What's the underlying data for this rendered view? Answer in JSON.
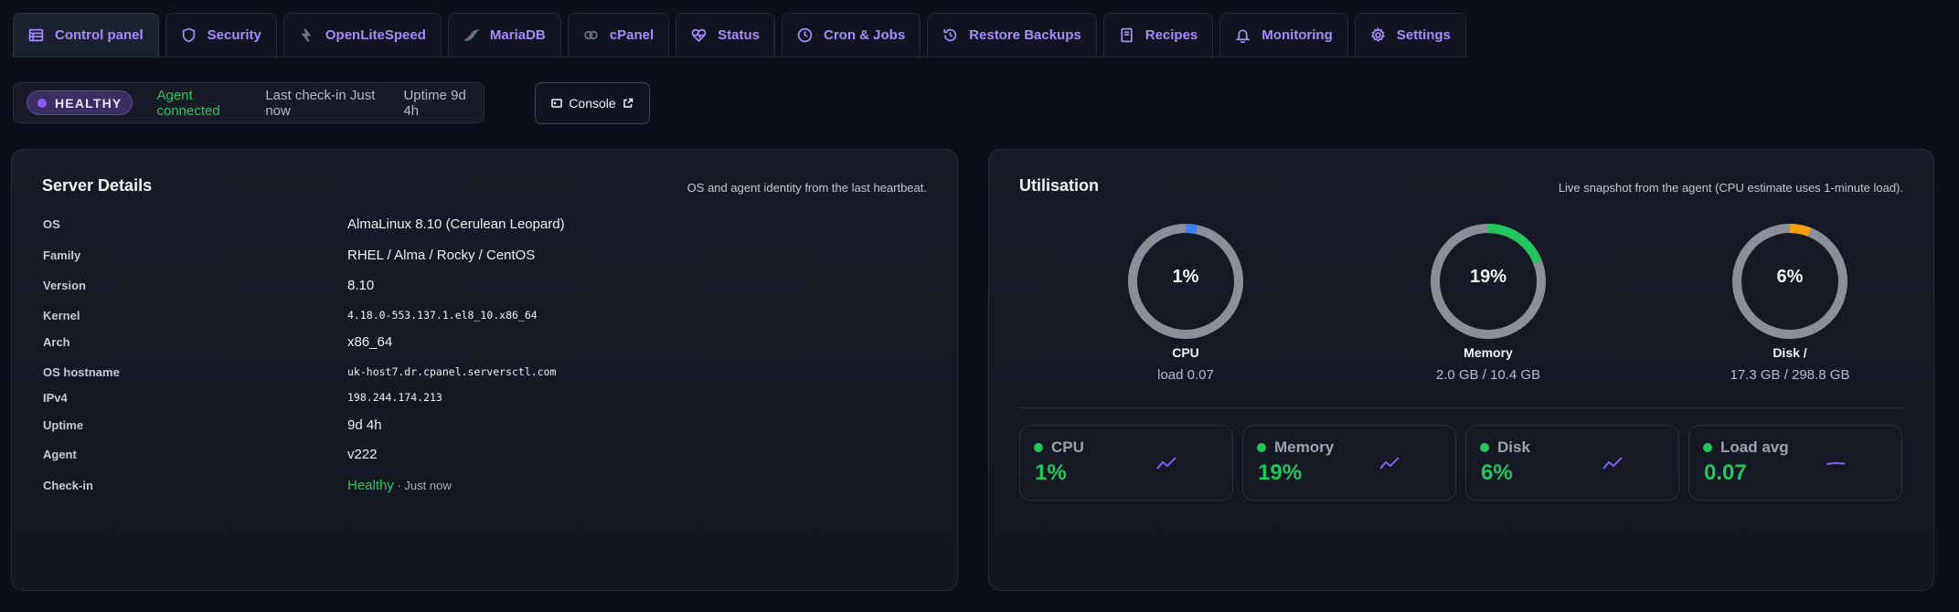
{
  "tabs": [
    {
      "label": "Control panel",
      "icon": "table-icon",
      "active": true
    },
    {
      "label": "Security",
      "icon": "shield-icon"
    },
    {
      "label": "OpenLiteSpeed",
      "icon": "openlitespeed-icon"
    },
    {
      "label": "MariaDB",
      "icon": "mariadb-icon"
    },
    {
      "label": "cPanel",
      "icon": "cpanel-icon"
    },
    {
      "label": "Status",
      "icon": "heart-pulse-icon"
    },
    {
      "label": "Cron & Jobs",
      "icon": "clock-icon"
    },
    {
      "label": "Restore Backups",
      "icon": "history-icon"
    },
    {
      "label": "Recipes",
      "icon": "book-icon"
    },
    {
      "label": "Monitoring",
      "icon": "bell-icon"
    },
    {
      "label": "Settings",
      "icon": "gear-icon"
    }
  ],
  "status": {
    "badge": "HEALTHY",
    "agent": "Agent connected",
    "checkin": "Last check-in Just now",
    "uptime": "Uptime 9d 4h",
    "console_label": "Console"
  },
  "server_details": {
    "title": "Server Details",
    "subtitle": "OS and agent identity from the last heartbeat.",
    "rows": [
      {
        "key": "OS",
        "value": "AlmaLinux 8.10 (Cerulean Leopard)"
      },
      {
        "key": "Family",
        "value": "RHEL / Alma / Rocky / CentOS"
      },
      {
        "key": "Version",
        "value": "8.10"
      },
      {
        "key": "Kernel",
        "value": "4.18.0-553.137.1.el8_10.x86_64"
      },
      {
        "key": "Arch",
        "value": "x86_64"
      },
      {
        "key": "OS hostname",
        "value": "uk-host7.dr.cpanel.serversctl.com"
      },
      {
        "key": "IPv4",
        "value": "198.244.174.213"
      },
      {
        "key": "Uptime",
        "value": "9d 4h"
      },
      {
        "key": "Agent",
        "value": "v222"
      },
      {
        "key": "Check-in",
        "value": "Healthy",
        "suffix": " · Just now"
      }
    ]
  },
  "utilisation": {
    "title": "Utilisation",
    "subtitle": "Live snapshot from the agent (CPU estimate uses 1-minute load).",
    "gauges": [
      {
        "pct_text": "1%",
        "percent": 1,
        "label": "CPU",
        "sub": "load 0.07",
        "color": "#3b82f6"
      },
      {
        "pct_text": "19%",
        "percent": 19,
        "label": "Memory",
        "sub": "2.0 GB / 10.4 GB",
        "color": "#22c55e"
      },
      {
        "pct_text": "6%",
        "percent": 6,
        "label": "Disk /",
        "sub": "17.3 GB / 298.8 GB",
        "color": "#f59e0b"
      }
    ],
    "stats": [
      {
        "name": "CPU",
        "value": "1%",
        "icon": "trend-up-icon"
      },
      {
        "name": "Memory",
        "value": "19%",
        "icon": "trend-up-icon"
      },
      {
        "name": "Disk",
        "value": "6%",
        "icon": "trend-up-icon"
      },
      {
        "name": "Load avg",
        "value": "0.07",
        "icon": "trend-flat-icon"
      }
    ]
  }
}
